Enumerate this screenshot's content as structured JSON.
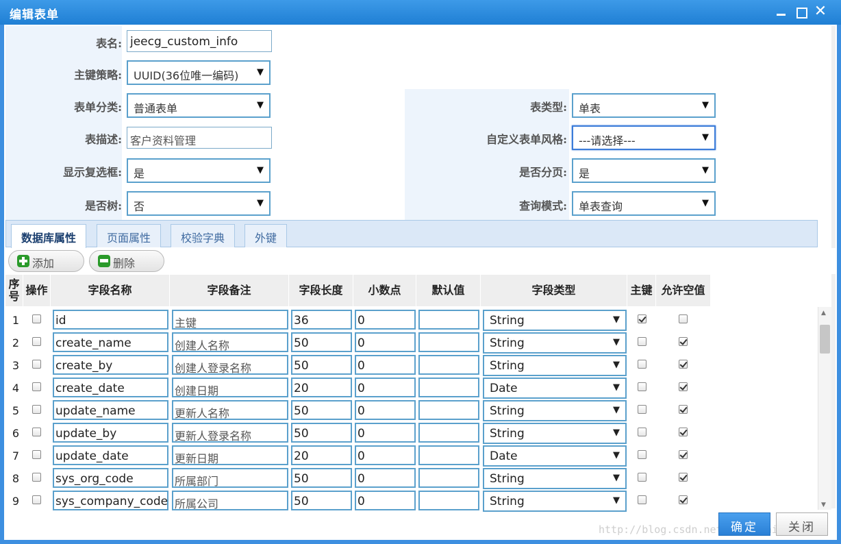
{
  "window": {
    "title": "编辑表单"
  },
  "form": {
    "table_name_label": "表名:",
    "table_name_value": "jeecg_custom_info",
    "pk_label": "主键策略:",
    "pk_value": "UUID(36位唯一编码)",
    "category_label": "表单分类:",
    "category_value": "普通表单",
    "table_type_label": "表类型:",
    "table_type_value": "单表",
    "desc_label": "表描述:",
    "desc_value": "客户资料管理",
    "style_label": "自定义表单风格:",
    "style_value": "---请选择---",
    "checkbox_label": "显示复选框:",
    "checkbox_value": "是",
    "paging_label": "是否分页:",
    "paging_value": "是",
    "tree_label": "是否树:",
    "tree_value": "否",
    "query_label": "查询模式:",
    "query_value": "单表查询"
  },
  "tabs": [
    "数据库属性",
    "页面属性",
    "校验字典",
    "外键"
  ],
  "toolbar": {
    "add_label": "添加",
    "delete_label": "删除"
  },
  "grid": {
    "headers": {
      "seq": "序号",
      "op": "操作",
      "name": "字段名称",
      "remark": "字段备注",
      "length": "字段长度",
      "decimal": "小数点",
      "default": "默认值",
      "type": "字段类型",
      "pk": "主键",
      "nullable": "允许空值"
    },
    "rows": [
      {
        "no": "1",
        "name": "id",
        "remark": "主键",
        "length": "36",
        "decimal": "0",
        "default": "",
        "type": "String",
        "pk": true,
        "nullable": false
      },
      {
        "no": "2",
        "name": "create_name",
        "remark": "创建人名称",
        "length": "50",
        "decimal": "0",
        "default": "",
        "type": "String",
        "pk": false,
        "nullable": true
      },
      {
        "no": "3",
        "name": "create_by",
        "remark": "创建人登录名称",
        "length": "50",
        "decimal": "0",
        "default": "",
        "type": "String",
        "pk": false,
        "nullable": true
      },
      {
        "no": "4",
        "name": "create_date",
        "remark": "创建日期",
        "length": "20",
        "decimal": "0",
        "default": "",
        "type": "Date",
        "pk": false,
        "nullable": true
      },
      {
        "no": "5",
        "name": "update_name",
        "remark": "更新人名称",
        "length": "50",
        "decimal": "0",
        "default": "",
        "type": "String",
        "pk": false,
        "nullable": true
      },
      {
        "no": "6",
        "name": "update_by",
        "remark": "更新人登录名称",
        "length": "50",
        "decimal": "0",
        "default": "",
        "type": "String",
        "pk": false,
        "nullable": true
      },
      {
        "no": "7",
        "name": "update_date",
        "remark": "更新日期",
        "length": "20",
        "decimal": "0",
        "default": "",
        "type": "Date",
        "pk": false,
        "nullable": true
      },
      {
        "no": "8",
        "name": "sys_org_code",
        "remark": "所属部门",
        "length": "50",
        "decimal": "0",
        "default": "",
        "type": "String",
        "pk": false,
        "nullable": true
      },
      {
        "no": "9",
        "name": "sys_company_code",
        "remark": "所属公司",
        "length": "50",
        "decimal": "0",
        "default": "",
        "type": "String",
        "pk": false,
        "nullable": true
      }
    ]
  },
  "footer": {
    "ok_label": "确定",
    "close_label": "关闭",
    "watermark": "http://blog.csdn.net/zhangdaiscott"
  }
}
